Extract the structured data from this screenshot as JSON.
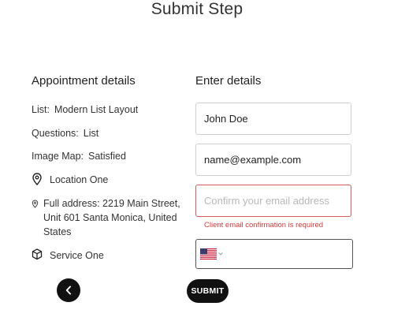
{
  "page": {
    "title": "Submit Step"
  },
  "appointment": {
    "heading": "Appointment details",
    "list": {
      "label": "List:",
      "value": "Modern List Layout"
    },
    "questions": {
      "label": "Questions:",
      "value": "List"
    },
    "image_map": {
      "label": "Image Map:",
      "value": "Satisfied"
    },
    "location": "Location One",
    "address_line1": "Full address: 2219 Main Street,",
    "address_line2": "Unit 601 Santa Monica, United",
    "address_line3": "States",
    "service": "Service One"
  },
  "form": {
    "heading": "Enter details",
    "name_value": "John Doe",
    "email_value": "name@example.com",
    "confirm_placeholder": "Confirm your email address",
    "confirm_error": "Client email confirmation is required",
    "phone_value": "",
    "submit_label": "SUBMIT"
  },
  "icons": {
    "location": "map-pin-icon",
    "address": "map-pin-small-icon",
    "service": "box-icon",
    "back": "chevron-left-icon",
    "flag": "us-flag-icon",
    "dropdown": "chevron-down-icon"
  },
  "colors": {
    "error": "#d03b3b",
    "button": "#111111",
    "border": "#cfcfcf"
  }
}
